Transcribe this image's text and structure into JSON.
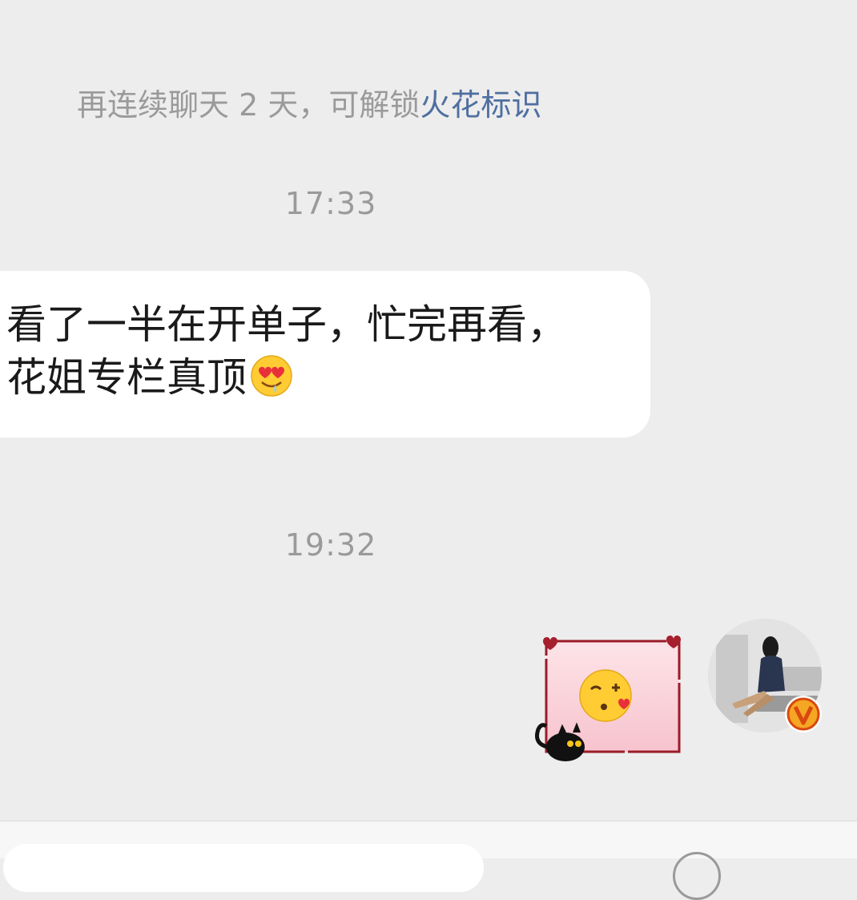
{
  "system_notice": {
    "prefix": "再连续聊天 2 天，可解锁",
    "link": "火花标识"
  },
  "messages": [
    {
      "timestamp": "17:33",
      "sender": "other",
      "line1": "看了一半在开单子，忙完再看，",
      "line2": "花姐专栏真顶",
      "emoji": "heart-eyes-drooling-emoji"
    },
    {
      "timestamp": "19:32",
      "sender": "self",
      "type": "sticker",
      "sticker": "kiss-face-frame-sticker"
    }
  ],
  "colors": {
    "background": "#ededed",
    "bubble": "#ffffff",
    "link": "#4e6fa0",
    "meta_text": "#9a9a9a",
    "badge": "#f5a623"
  }
}
